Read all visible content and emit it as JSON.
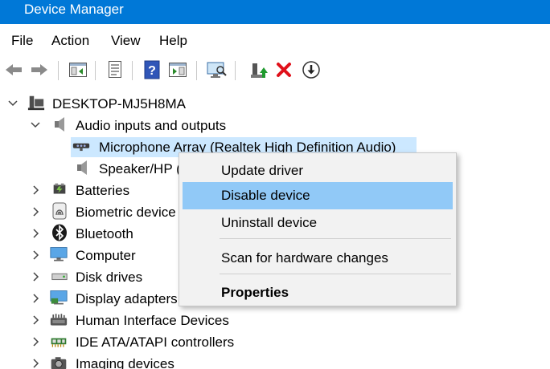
{
  "window": {
    "title": "Device Manager"
  },
  "menu": [
    "File",
    "Action",
    "View",
    "Help"
  ],
  "toolbar": {
    "icons": [
      "back-icon",
      "forward-icon",
      "show-hide-console-tree-icon",
      "properties-icon",
      "help-icon",
      "action-pane-icon",
      "scan-hardware-icon",
      "update-driver-icon",
      "uninstall-icon",
      "disable-device-icon"
    ]
  },
  "tree": {
    "root": "DESKTOP-MJ5H8MA",
    "audio_category": "Audio inputs and outputs",
    "audio_children": [
      "Microphone Array (Realtek High Definition Audio)",
      "Speaker/HP (I"
    ],
    "categories": [
      "Batteries",
      "Biometric device",
      "Bluetooth",
      "Computer",
      "Disk drives",
      "Display adapters",
      "Human Interface Devices",
      "IDE ATA/ATAPI controllers",
      "Imaging devices"
    ]
  },
  "context_menu": {
    "items": [
      "Update driver",
      "Disable device",
      "Uninstall device",
      "Scan for hardware changes",
      "Properties"
    ],
    "highlighted": "Disable device"
  },
  "colors": {
    "titlebar": "#0078d7",
    "selection": "#cce8ff",
    "menu_hover": "#91c9f7",
    "menu_bg": "#f2f2f2"
  }
}
